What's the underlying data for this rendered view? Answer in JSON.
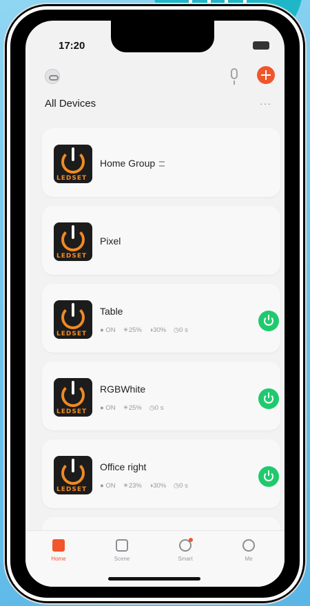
{
  "status_bar": {
    "time": "17:20"
  },
  "header": {
    "title": "All Devices",
    "more_label": "···"
  },
  "devices": [
    {
      "name": "Home Group",
      "is_group": true
    },
    {
      "name": "Pixel"
    },
    {
      "name": "Table",
      "status": {
        "power": "ON",
        "brightness": "25%",
        "color_temp": "30%",
        "timer": "0 s"
      },
      "is_on": true
    },
    {
      "name": "RGBWhite",
      "status": {
        "power": "ON",
        "brightness": "25%",
        "timer": "0 s"
      },
      "is_on": true
    },
    {
      "name": "Office right",
      "status": {
        "power": "ON",
        "brightness": "23%",
        "color_temp": "30%",
        "timer": "0 s"
      },
      "is_on": true
    }
  ],
  "device_thumb_brand": "LEDSET",
  "tabs": [
    {
      "label": "Home",
      "icon": "home-icon",
      "active": true
    },
    {
      "label": "Scene",
      "icon": "checkbox-icon"
    },
    {
      "label": "Smart",
      "icon": "smart-icon"
    },
    {
      "label": "Me",
      "icon": "person-icon"
    }
  ],
  "colors": {
    "accent": "#f0562a",
    "power_on": "#1fca6e",
    "badge": "#1fb7c8"
  },
  "icons": [
    "grid-icon",
    "profile-icon",
    "microphone-icon",
    "add-icon",
    "more-icon",
    "power-icon",
    "group-icon"
  ]
}
